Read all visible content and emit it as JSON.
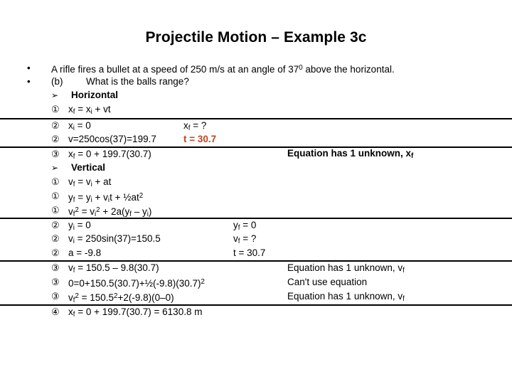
{
  "slide": {
    "title": "Projectile Motion – Example 3c",
    "accent_red": "#c0441e",
    "text_color": "#000000",
    "background": "#ffffff"
  },
  "intro": {
    "bullet_glyph": "•",
    "line1": "A rifle fires a bullet at a speed of 250 m/s at an angle of 37",
    "line1_sup": "0",
    "line1_tail": " above the horizontal.",
    "line2_label": "(b)",
    "line2_text": "What is the balls range?"
  },
  "sections": {
    "arrow_glyph": "➢",
    "horizontal_heading": "Horizontal",
    "vertical_heading": "Vertical"
  },
  "markers": {
    "one": "①",
    "two": "②",
    "three": "③",
    "four": "④"
  },
  "horizontal_block": {
    "eq1": {
      "marker": "①",
      "lhs": "x",
      "lhs_sub": "f",
      "text_a": " = x",
      "text_a_sub": "i",
      "text_b": " + vt"
    },
    "row2": {
      "marker": "②",
      "left": "x",
      "left_sub": "i",
      "left_tail": " = 0",
      "mid": "x",
      "mid_sub": "f",
      "mid_tail": " = ?"
    },
    "row3": {
      "marker": "②",
      "left": "v=250cos(37)=199.7",
      "red": "t = 30.7"
    },
    "row4": {
      "marker": "③",
      "left": "x",
      "left_sub": "f",
      "left_tail": " = 0 + 199.7(30.7)",
      "right": "Equation has 1 unknown, x",
      "right_sub": "f"
    }
  },
  "vertical_block": {
    "eq1": {
      "marker": "①",
      "a": "v",
      "a_sub": "f",
      "b": " = v",
      "b_sub": "i",
      "c": " + at"
    },
    "eq2": {
      "marker": "①",
      "a": "y",
      "a_sub": "f",
      "b": " = y",
      "b_sub": "i",
      "c": " + v",
      "c_sub": "i",
      "d": "t + ½at",
      "d_sup": "2"
    },
    "eq3": {
      "marker": "①",
      "a": "v",
      "a_sub": "f",
      "a_sup": "2",
      "b": " = v",
      "b_sub": "i",
      "b_sup": "2",
      "c": " + 2a(y",
      "c_sub": "f",
      "d": " – y",
      "d_sub": "i",
      "e": ")"
    },
    "row4": {
      "marker": "②",
      "left": "y",
      "left_sub": "i",
      "left_tail": " = 0",
      "mid": "y",
      "mid_sub": "f",
      "mid_tail": " = 0"
    },
    "row5": {
      "marker": "②",
      "left": "v",
      "left_sub": "i",
      "left_tail": " = 250sin(37)=150.5",
      "mid": "v",
      "mid_sub": "f",
      "mid_tail": " = ?"
    },
    "row6": {
      "marker": "②",
      "left": "a = -9.8",
      "mid": "t = 30.7"
    },
    "row7": {
      "marker": "③",
      "left": "v",
      "left_sub": "f",
      "left_tail": " = 150.5 – 9.8(30.7)",
      "right": "Equation has 1 unknown, v",
      "right_sub": "f"
    },
    "row8": {
      "marker": "③",
      "left": "0=0+150.5(30.7)+½(-9.8)(30.7)",
      "left_sup": "2",
      "right": "Can't use equation"
    },
    "row9": {
      "marker": "③",
      "left": "v",
      "left_sub": "f",
      "left_sup": "2",
      "left_tail": " = 150.5",
      "left_tail_sup": "2",
      "left_tail2": "+2(-9.8)(0–0)",
      "right": "Equation has 1 unknown, v",
      "right_sub": "f"
    },
    "row10": {
      "marker": "④",
      "left": "x",
      "left_sub": "f",
      "left_tail": " = 0 + 199.7(30.7) = 6130.8 m"
    }
  }
}
